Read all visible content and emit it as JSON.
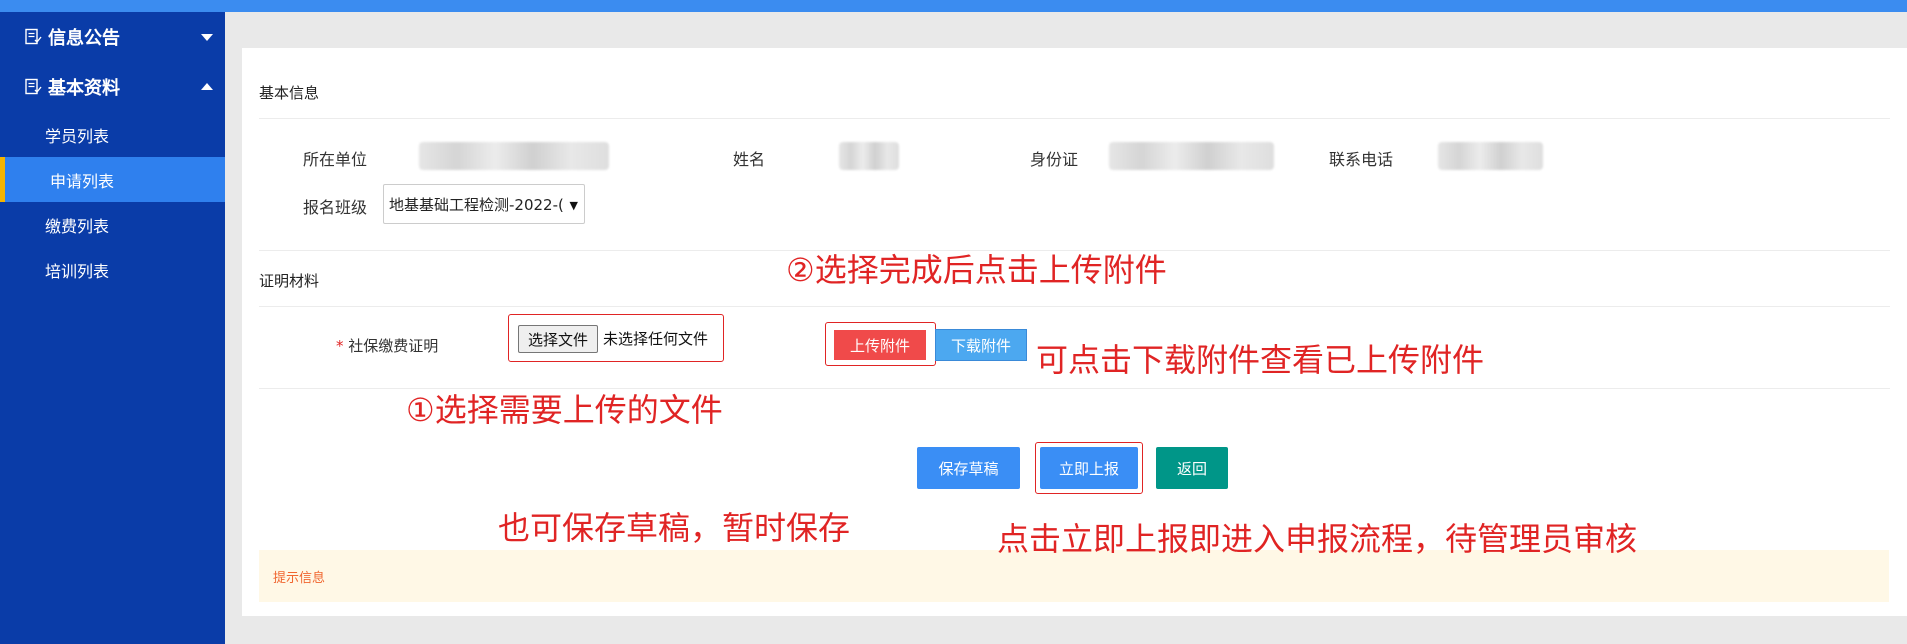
{
  "sidebar": {
    "groups": [
      {
        "label": "信息公告",
        "expanded": false
      },
      {
        "label": "基本资料",
        "expanded": true
      }
    ],
    "items": [
      {
        "label": "学员列表",
        "active": false
      },
      {
        "label": "申请列表",
        "active": true
      },
      {
        "label": "缴费列表",
        "active": false
      },
      {
        "label": "培训列表",
        "active": false
      }
    ]
  },
  "basic": {
    "section_title": "基本信息",
    "unit_label": "所在单位",
    "name_label": "姓名",
    "id_label": "身份证",
    "phone_label": "联系电话",
    "class_label": "报名班级",
    "class_value": "地基基础工程检测-2022-("
  },
  "materials": {
    "section_title": "证明材料",
    "required_mark": "*",
    "social_label": "社保缴费证明",
    "choose_file": "选择文件",
    "no_file": "未选择任何文件",
    "upload": "上传附件",
    "download": "下载附件"
  },
  "actions": {
    "save": "保存草稿",
    "submit": "立即上报",
    "back": "返回"
  },
  "hint": "提示信息",
  "annotations": {
    "step2": "②选择完成后点击上传附件",
    "download_tip": "可点击下载附件查看已上传附件",
    "step1": "①选择需要上传的文件",
    "save_tip": "也可保存草稿，暂时保存",
    "submit_tip": "点击立即上报即进入申报流程，待管理员审核"
  },
  "colors": {
    "sidebar_bg": "#0a3ca8",
    "sidebar_active": "#2f80ee",
    "accent_bar": "#f5b400",
    "upload_btn": "#f04a4a",
    "download_btn": "#4ca8f0",
    "primary_btn": "#3a8ef5",
    "back_btn": "#009688",
    "annotation": "#e02424"
  }
}
